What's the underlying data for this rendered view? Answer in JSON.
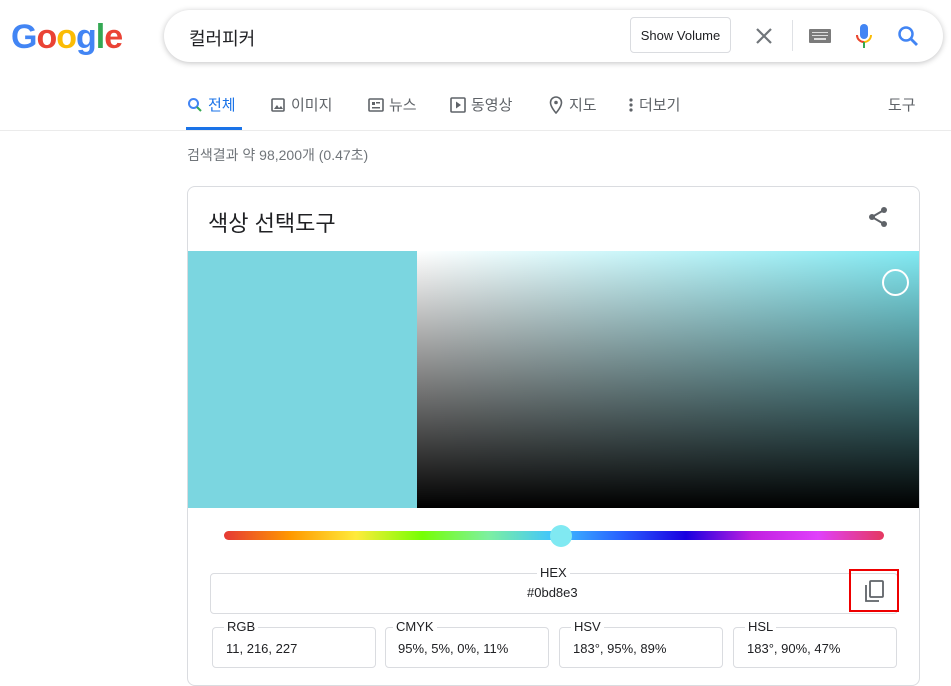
{
  "logo": {
    "text": "Google",
    "colors": [
      "#4285f4",
      "#ea4335",
      "#fbbc05",
      "#4285f4",
      "#34a853",
      "#ea4335"
    ]
  },
  "search": {
    "query": "컬러피커",
    "show_volume": "Show Volume"
  },
  "tabs": [
    {
      "label": "전체",
      "icon": "search-icon",
      "active": true
    },
    {
      "label": "이미지",
      "icon": "image-icon"
    },
    {
      "label": "뉴스",
      "icon": "news-icon"
    },
    {
      "label": "동영상",
      "icon": "video-icon"
    },
    {
      "label": "지도",
      "icon": "map-pin-icon"
    },
    {
      "label": "더보기",
      "icon": "more-vert-icon"
    }
  ],
  "tools_label": "도구",
  "stats": "검색결과 약 98,200개 (0.47초)",
  "picker": {
    "title": "색상 선택도구",
    "swatch_color": "#7bd6e0",
    "hex_label": "HEX",
    "hex_value": "#0bd8e3",
    "fields": [
      {
        "label": "RGB",
        "value": "11, 216, 227"
      },
      {
        "label": "CMYK",
        "value": "95%, 5%, 0%, 11%"
      },
      {
        "label": "HSV",
        "value": "183°, 95%, 89%"
      },
      {
        "label": "HSL",
        "value": "183°, 90%, 47%"
      }
    ]
  }
}
